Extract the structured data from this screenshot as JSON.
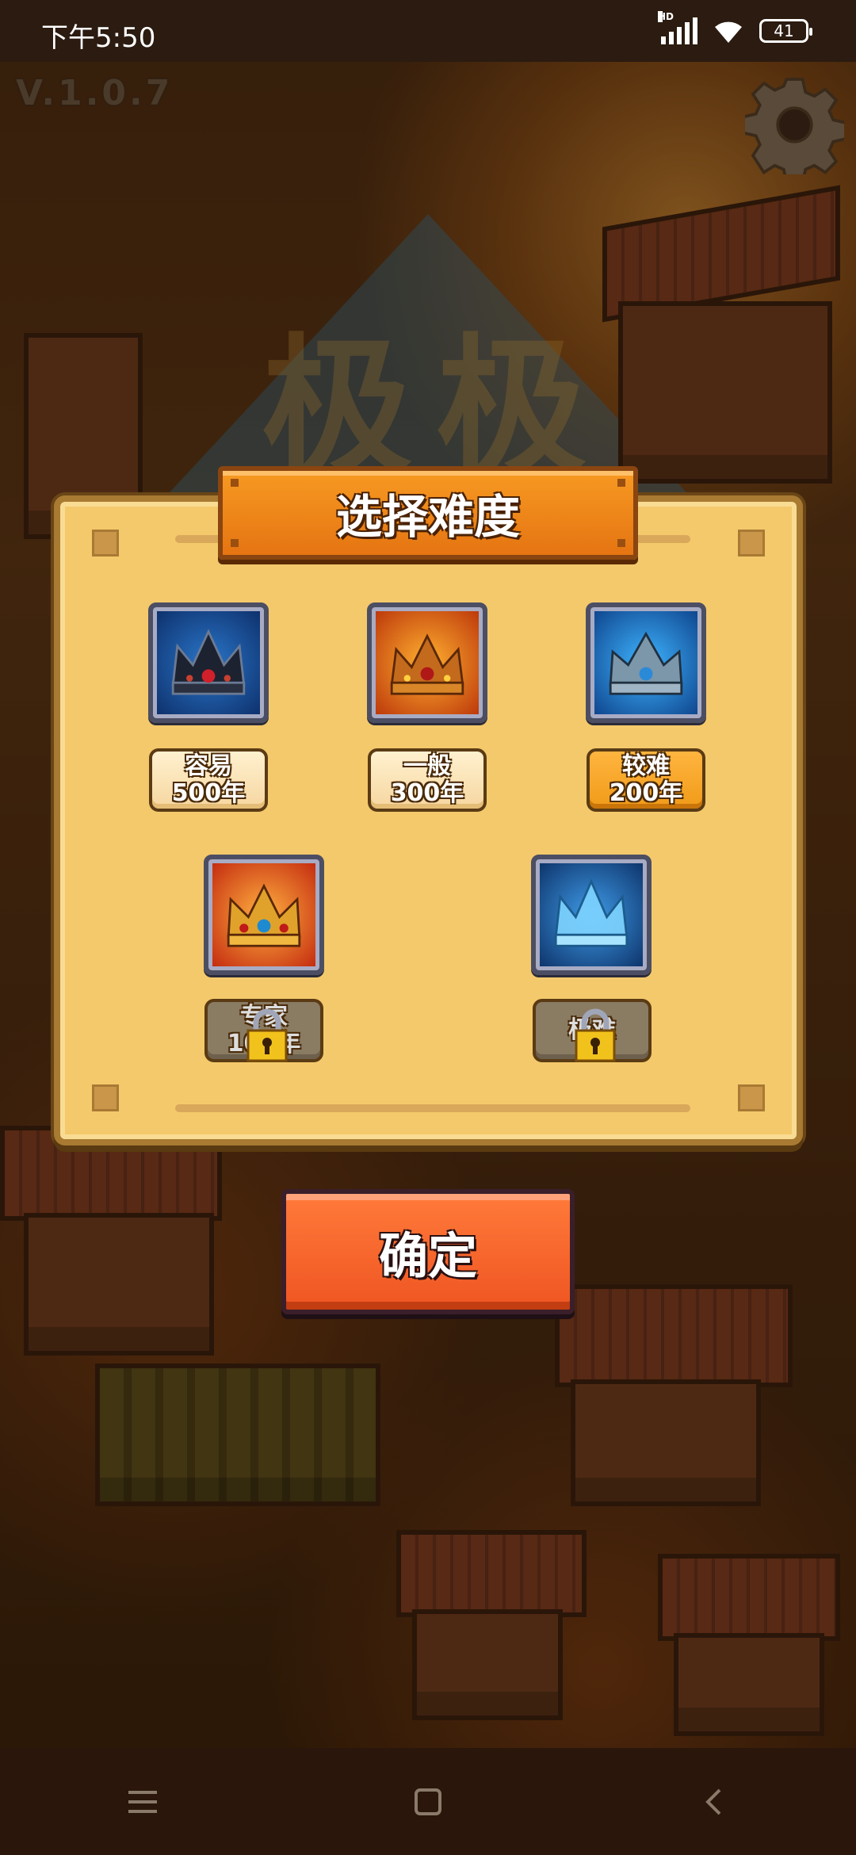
{
  "status_bar": {
    "time": "下午5:50",
    "network": "HD",
    "battery": "41"
  },
  "version": "V.1.0.7",
  "dialog": {
    "title": "选择难度",
    "difficulties": [
      {
        "name": "容易",
        "years": "500年",
        "locked": false,
        "style": "light",
        "crown": "dark-crown-icon"
      },
      {
        "name": "一般",
        "years": "300年",
        "locked": false,
        "style": "light",
        "crown": "gold-crown-icon"
      },
      {
        "name": "较难",
        "years": "200年",
        "locked": false,
        "style": "orange",
        "crown": "silver-crown-icon"
      },
      {
        "name": "专家",
        "years": "100年",
        "locked": true,
        "style": "locked",
        "crown": "royal-crown-icon"
      },
      {
        "name": "极难",
        "years": "",
        "locked": true,
        "style": "locked",
        "crown": "ice-crown-icon"
      }
    ]
  },
  "confirm_label": "确定",
  "colors": {
    "accent_orange": "#f08a1a",
    "confirm_red": "#ef5522",
    "panel": "#f4c96b"
  },
  "navbar": {
    "items": [
      "menu-icon",
      "home-icon",
      "back-icon"
    ]
  }
}
